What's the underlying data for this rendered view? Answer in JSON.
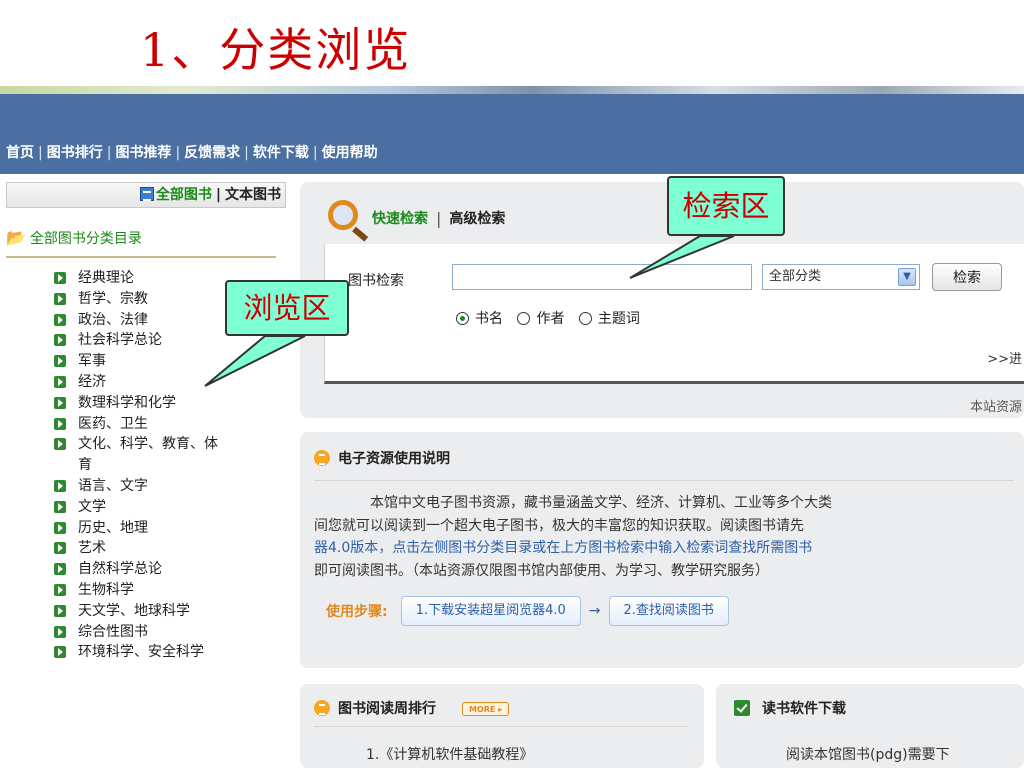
{
  "slide_title": "1、分类浏览",
  "nav": {
    "separator": "|",
    "links": [
      "首页",
      "图书排行",
      "图书推荐",
      "反馈需求",
      "软件下载",
      "使用帮助"
    ]
  },
  "sidebar": {
    "tab_active": "全部图书",
    "tab_divider": "|",
    "tab_other": "文本图书",
    "root_label": "全部图书分类目录",
    "categories": [
      "经典理论",
      "哲学、宗教",
      "政治、法律",
      "社会科学总论",
      "军事",
      "经济",
      "数理科学和化学",
      "医药、卫生",
      "文化、科学、教育、体",
      "育",
      "语言、文字",
      "文学",
      "历史、地理",
      "艺术",
      "自然科学总论",
      "生物科学",
      "天文学、地球科学",
      "综合性图书",
      "环境科学、安全科学"
    ]
  },
  "search": {
    "quick_label": "快速检索",
    "divider": "|",
    "advanced_label": "高级检索",
    "field_label": "图书检索",
    "input_value": "",
    "select_value": "全部分类",
    "button_label": "检索",
    "radio_options": [
      "书名",
      "作者",
      "主题词"
    ],
    "radio_selected": "书名",
    "advanced_link": ">>进",
    "resource_note": "本站资源"
  },
  "info": {
    "title": "电子资源使用说明",
    "lines": [
      "本馆中文电子图书资源，藏书量涵盖文学、经济、计算机、工业等多个大类",
      "间您就可以阅读到一个超大电子图书，极大的丰富您的知识获取。阅读图书请先",
      "器4.0版本，点击左侧图书分类目录或在上方图书检索中输入检索词查找所需图书",
      "即可阅读图书。（本站资源仅限图书馆内部使用、为学习、教学研究服务）"
    ],
    "steps_label": "使用步骤:",
    "step1": "1.下载安装超星阅览器4.0",
    "step_arrow": "→",
    "step2": "2.查找阅读图书"
  },
  "ranking": {
    "title": "图书阅读周排行",
    "more_label": "MORE",
    "items": [
      "1.《计算机软件基础教程》"
    ]
  },
  "software": {
    "title": "读书软件下载",
    "text": "阅读本馆图书(pdg)需要下"
  },
  "callouts": {
    "search_area": "检索区",
    "browse_area": "浏览区"
  },
  "colors": {
    "title_red": "#cc0000",
    "nav_blue": "#4a6fa0",
    "green_link": "#1a8a1a",
    "callout_fill": "#7fffd4",
    "orange_accent": "#e08a1e"
  }
}
